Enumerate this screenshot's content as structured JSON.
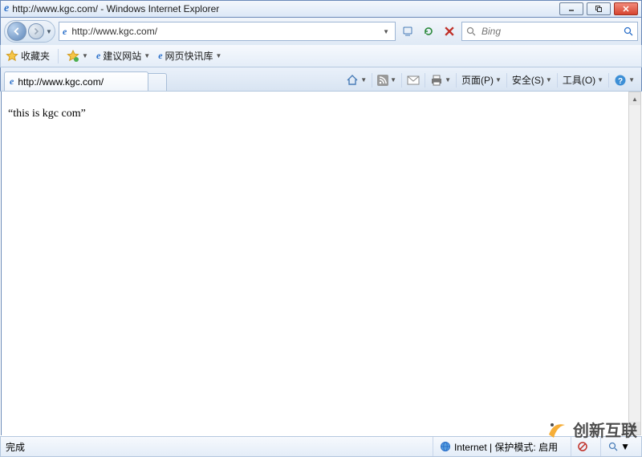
{
  "window": {
    "title": "http://www.kgc.com/ - Windows Internet Explorer"
  },
  "address": {
    "url": "http://www.kgc.com/"
  },
  "search": {
    "placeholder": "Bing"
  },
  "favorites": {
    "button": "收藏夹",
    "suggested": "建议网站",
    "slice": "网页快讯库"
  },
  "tab": {
    "title": "http://www.kgc.com/"
  },
  "commandbar": {
    "page": "页面(P)",
    "safety": "安全(S)",
    "tools": "工具(O)"
  },
  "page_content": {
    "body_text": "“this is kgc com”"
  },
  "statusbar": {
    "left": "完成",
    "zone": "Internet | 保护模式: 启用"
  },
  "watermark": {
    "text": "创新互联"
  }
}
